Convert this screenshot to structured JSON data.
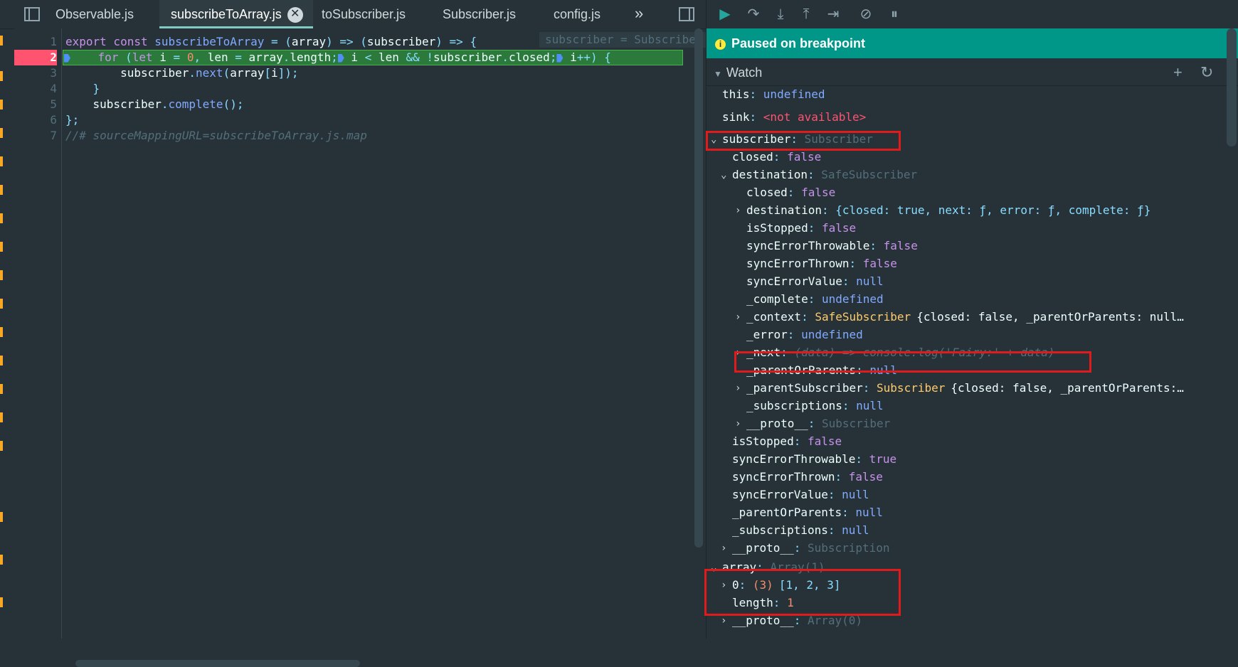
{
  "tabs": [
    {
      "label": "Observable.js",
      "active": false
    },
    {
      "label": "subscribeToArray.js",
      "active": true
    },
    {
      "label": "toSubscriber.js",
      "active": false
    },
    {
      "label": "Subscriber.js",
      "active": false
    },
    {
      "label": "config.js",
      "active": false
    }
  ],
  "tabs_overflow": "»",
  "editor": {
    "inline_hint": "subscriber = Subscriber",
    "lines": [
      {
        "n": "1"
      },
      {
        "n": "2",
        "breakpoint": true
      },
      {
        "n": "3"
      },
      {
        "n": "4"
      },
      {
        "n": "5"
      },
      {
        "n": "6"
      },
      {
        "n": "7"
      }
    ]
  },
  "debugger": {
    "status": "Paused on breakpoint",
    "watch_title": "Watch",
    "watch_add": "+",
    "watch_refresh": "↻"
  },
  "watch": [
    {
      "key": "this",
      "value": "undefined"
    },
    {
      "key": "sink",
      "value": "<not available>"
    },
    {
      "key": "subscriber",
      "value": "Subscriber"
    },
    {
      "key": "closed",
      "value": "false"
    },
    {
      "key": "destination",
      "value": "SafeSubscriber"
    },
    {
      "key": "closed",
      "value": "false"
    },
    {
      "key": "destination",
      "value": "{closed: true, next: ƒ, error: ƒ, complete: ƒ}"
    },
    {
      "key": "isStopped",
      "value": "false"
    },
    {
      "key": "syncErrorThrowable",
      "value": "false"
    },
    {
      "key": "syncErrorThrown",
      "value": "false"
    },
    {
      "key": "syncErrorValue",
      "value": "null"
    },
    {
      "key": "_complete",
      "value": "undefined"
    },
    {
      "key": "_context",
      "value": "SafeSubscriber",
      "extra": "{closed: false, _parentOrParents: null…"
    },
    {
      "key": "_error",
      "value": "undefined"
    },
    {
      "key": "_next",
      "value": "(data) => console.log('Fairy:' + data)"
    },
    {
      "key": "_parentOrParents",
      "value": "null"
    },
    {
      "key": "_parentSubscriber",
      "value": "Subscriber",
      "extra": "{closed: false, _parentOrParents:…"
    },
    {
      "key": "_subscriptions",
      "value": "null"
    },
    {
      "key": "__proto__",
      "value": "Subscriber"
    },
    {
      "key": "isStopped",
      "value": "false"
    },
    {
      "key": "syncErrorThrowable",
      "value": "true"
    },
    {
      "key": "syncErrorThrown",
      "value": "false"
    },
    {
      "key": "syncErrorValue",
      "value": "null"
    },
    {
      "key": "_parentOrParents",
      "value": "null"
    },
    {
      "key": "_subscriptions",
      "value": "null"
    },
    {
      "key": "__proto__",
      "value": "Subscription"
    },
    {
      "key": "array",
      "value": "Array(1)"
    },
    {
      "key": "0",
      "value": "(3)",
      "extra": "[1, 2, 3]"
    },
    {
      "key": "length",
      "value": "1"
    },
    {
      "key": "__proto__",
      "value": "Array(0)"
    }
  ],
  "colors": {
    "background": "#263238",
    "breakpoint": "#ff5370",
    "paused_banner": "#009688",
    "current_line": "#2b7a3b",
    "annotation_box": "#e01b1b"
  }
}
